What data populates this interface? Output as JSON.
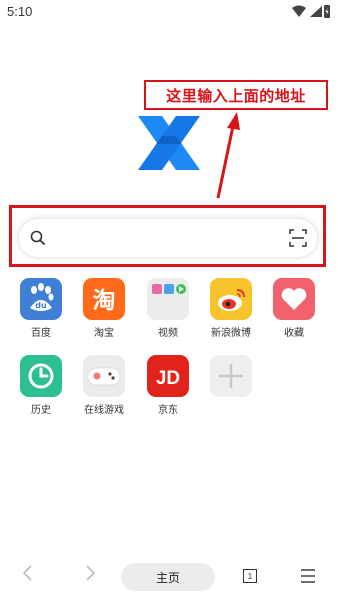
{
  "status": {
    "time": "5:10"
  },
  "annotation": {
    "text": "这里输入上面的地址",
    "color": "#d8141b"
  },
  "search": {
    "placeholder": ""
  },
  "shortcuts": [
    {
      "label": "百度",
      "icon": "baidu-icon",
      "color": "#3f7fd6"
    },
    {
      "label": "淘宝",
      "icon": "taobao-icon",
      "color": "#ff6a1a"
    },
    {
      "label": "视频",
      "icon": "video-folder-icon",
      "color": "#e9e9e9"
    },
    {
      "label": "新浪微博",
      "icon": "weibo-icon",
      "color": "#f7c52b"
    },
    {
      "label": "收藏",
      "icon": "heart-icon",
      "color": "#f1626c"
    },
    {
      "label": "历史",
      "icon": "clock-icon",
      "color": "#2dbf93"
    },
    {
      "label": "在线游戏",
      "icon": "gamepad-icon",
      "color": "#ececec"
    },
    {
      "label": "京东",
      "icon": "jd-icon",
      "color": "#e2231a"
    },
    {
      "label": "",
      "icon": "plus-icon",
      "color": "#eeeeee"
    }
  ],
  "jd_text": "JD",
  "taobao_text": "淘",
  "baidu_text": "du",
  "bottom_nav": {
    "home_label": "主页",
    "tab_count": "1"
  }
}
